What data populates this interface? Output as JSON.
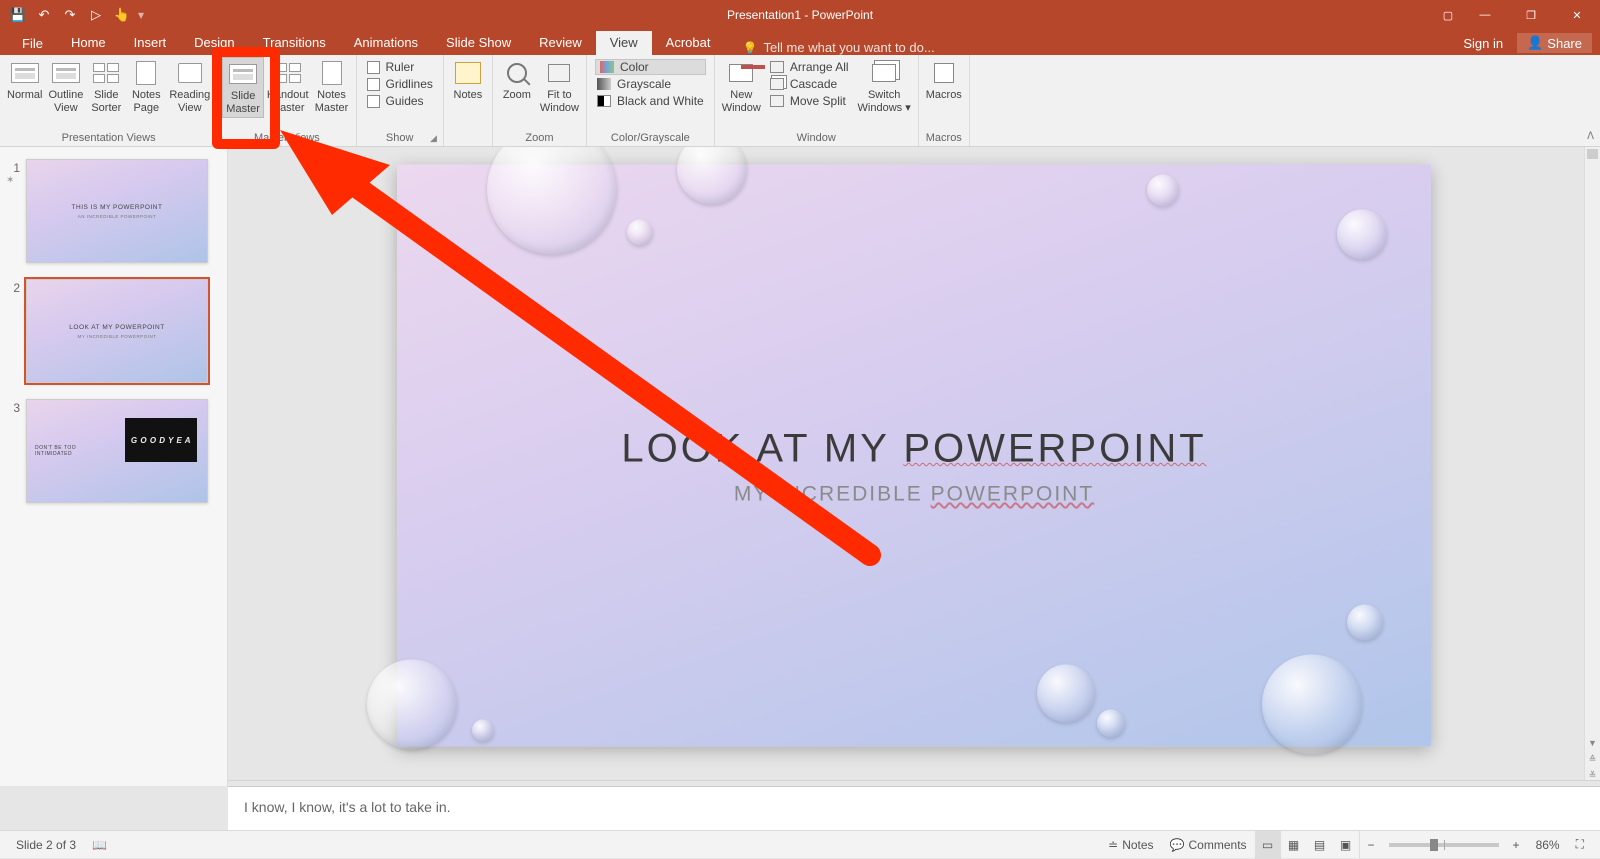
{
  "app_title": "Presentation1 - PowerPoint",
  "qat": {
    "save": "💾",
    "undo": "↶",
    "redo": "↷",
    "start": "▷",
    "touch": "👆"
  },
  "tabs": {
    "file": "File",
    "items": [
      "Home",
      "Insert",
      "Design",
      "Transitions",
      "Animations",
      "Slide Show",
      "Review",
      "View",
      "Acrobat"
    ],
    "active": "View",
    "tellme": "Tell me what you want to do..."
  },
  "account": {
    "signin": "Sign in",
    "share": "Share"
  },
  "ribbon": {
    "presentation_views": {
      "label": "Presentation Views",
      "normal": "Normal",
      "outline": "Outline\nView",
      "sorter": "Slide\nSorter",
      "notes_page": "Notes\nPage",
      "reading": "Reading\nView"
    },
    "master_views": {
      "label": "Master Views",
      "slide_master": "Slide\nMaster",
      "handout_master": "Handout\nMaster",
      "notes_master": "Notes\nMaster"
    },
    "show": {
      "label": "Show",
      "ruler": "Ruler",
      "gridlines": "Gridlines",
      "guides": "Guides"
    },
    "notes_btn": "Notes",
    "zoom": {
      "label": "Zoom",
      "zoom": "Zoom",
      "fit": "Fit to\nWindow"
    },
    "color": {
      "label": "Color/Grayscale",
      "color": "Color",
      "gray": "Grayscale",
      "bw": "Black and White"
    },
    "window": {
      "label": "Window",
      "new": "New\nWindow",
      "arrange": "Arrange All",
      "cascade": "Cascade",
      "split": "Move Split",
      "switch": "Switch\nWindows"
    },
    "macros": {
      "label": "Macros",
      "btn": "Macros"
    }
  },
  "thumbs": [
    {
      "num": "1",
      "title": "THIS IS MY POWERPOINT",
      "sub": "AN INCREDIBLE POWERPOINT"
    },
    {
      "num": "2",
      "title": "LOOK AT MY POWERPOINT",
      "sub": "MY INCREDIBLE POWERPOINT"
    },
    {
      "num": "3",
      "title": "DON'T BE TOO INTIMIDATED",
      "sub": "",
      "media": "G O O D Y E A"
    }
  ],
  "slide": {
    "heading_pre": "LOOK AT MY ",
    "heading_u": "POWERPOINT",
    "sub_pre": "MY INCREDIBLE ",
    "sub_u": "POWERPOINT"
  },
  "notes_text": "I know, I know, it's a lot to take in.",
  "status": {
    "slide": "Slide 2 of 3",
    "notes": "Notes",
    "comments": "Comments",
    "zoom_pct": "86%"
  }
}
